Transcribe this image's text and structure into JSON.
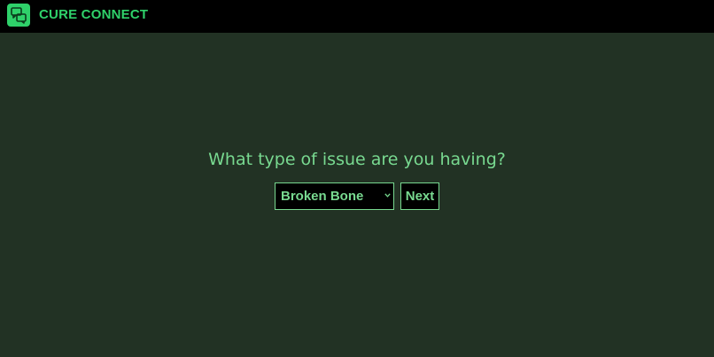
{
  "header": {
    "brand": "CURE CONNECT",
    "logo_icon": "chat-bubbles-icon"
  },
  "main": {
    "question": "What type of issue are you having?",
    "issue_select": {
      "selected": "Broken Bone",
      "chevron_icon": "chevron-down-icon"
    },
    "next_label": "Next"
  },
  "colors": {
    "background": "#223224",
    "topbar": "#000000",
    "brand": "#2fd16a",
    "accent": "#78d990"
  }
}
